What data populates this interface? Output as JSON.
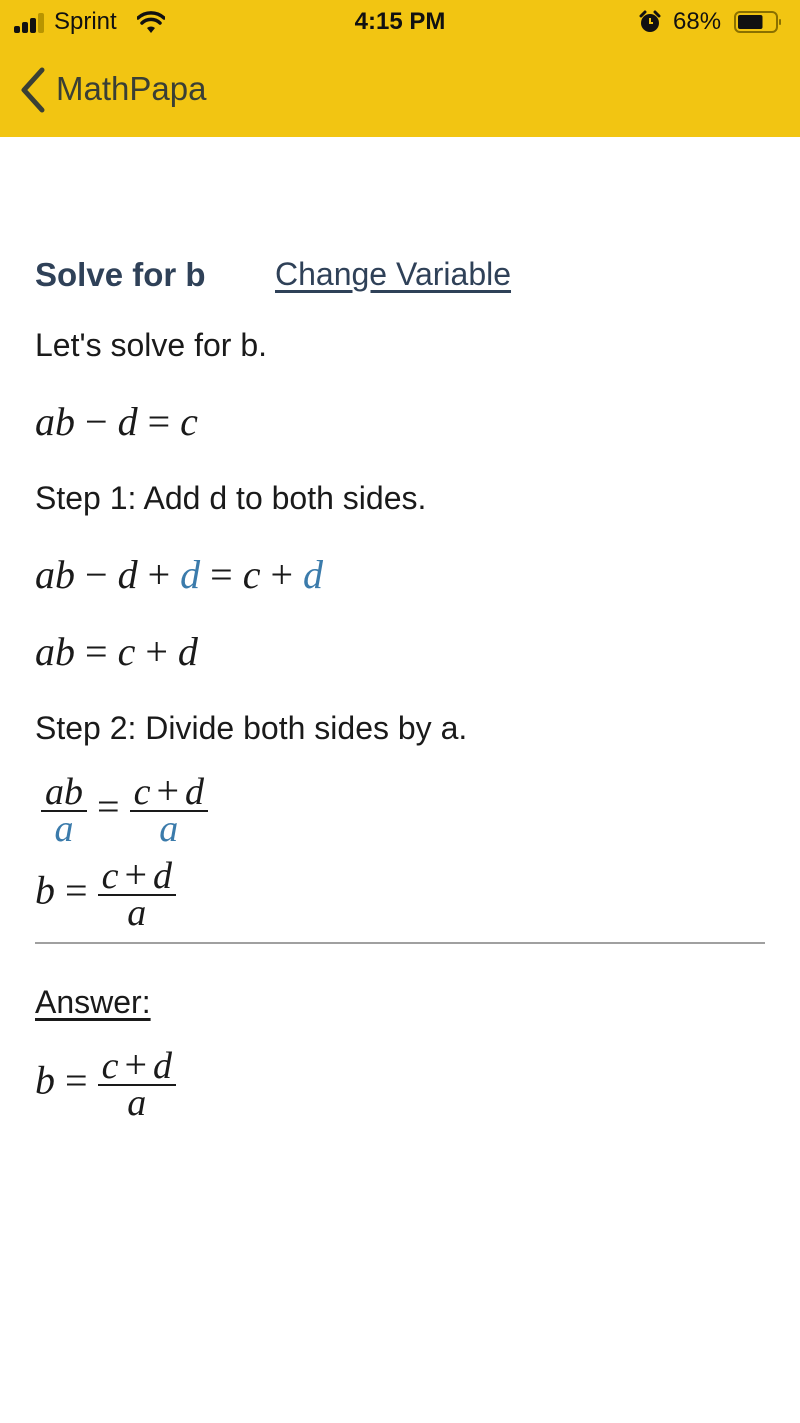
{
  "status_bar": {
    "carrier": "Sprint",
    "time": "4:15 PM",
    "battery_percent": "68%",
    "battery_level": 0.68,
    "icons": [
      "signal-icon",
      "wifi-icon",
      "alarm-icon",
      "battery-icon"
    ]
  },
  "nav": {
    "back_label": "MathPapa",
    "back_icon": "chevron-left-icon",
    "bar_color": "#f2c512"
  },
  "header": {
    "title": "Solve for b",
    "change_variable": "Change Variable"
  },
  "intro": "Let's solve for b.",
  "equation": {
    "lhs": [
      "a",
      "b"
    ],
    "minus": "−",
    "d": "d",
    "eq": "=",
    "rhs": "c"
  },
  "steps": [
    {
      "label": "Step 1: Add d to both sides.",
      "lines": [
        {
          "text": "ab − d + d = c + d",
          "highlight": [
            "d (added to left)",
            "d (added to right)"
          ]
        },
        {
          "text": "ab = c + d"
        }
      ]
    },
    {
      "label": "Step 2: Divide both sides by a.",
      "lines": [
        {
          "text": "ab/a = (c + d)/a",
          "highlight": [
            "a (left denominator)",
            "a (right denominator)"
          ]
        },
        {
          "text": "b = (c + d)/a"
        }
      ]
    }
  ],
  "sym": {
    "a": "a",
    "b": "b",
    "c": "c",
    "d": "d",
    "minus": "−",
    "plus": "+",
    "eq": "="
  },
  "answer": {
    "label": "Answer:",
    "text": "b = (c + d)/a"
  },
  "colors": {
    "highlight": "#3b7bab",
    "heading": "#2f4158",
    "text": "#1a1a1a"
  }
}
